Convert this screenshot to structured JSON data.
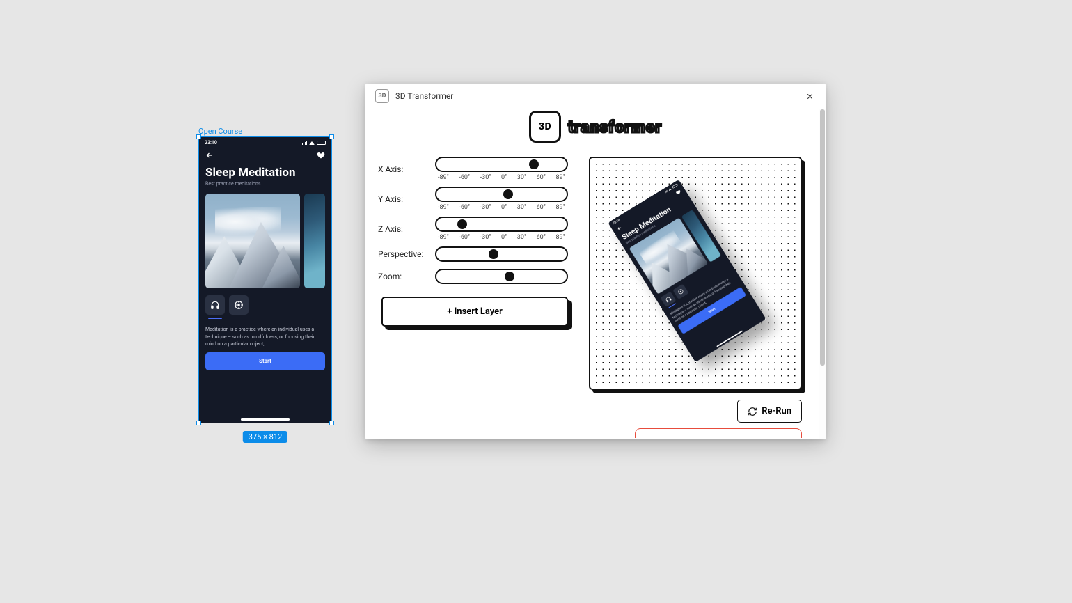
{
  "frame": {
    "label": "Open Course",
    "size_badge": "375 × 812"
  },
  "phone": {
    "status_time": "23:10",
    "title": "Sleep Meditation",
    "subtitle": "Best practice meditations",
    "description": "Meditation is a practice where an individual uses a technique – such as mindfulness, or focusing their mind on a particular object,",
    "start_label": "Start"
  },
  "plugin": {
    "window_title": "3D Transformer",
    "icon_label": "3D",
    "logo_text": "transformer",
    "logo_badge": "3D",
    "ticks": [
      "-89°",
      "-60°",
      "-30°",
      "0°",
      "30°",
      "60°",
      "89°"
    ],
    "controls": [
      {
        "label": "X Axis:",
        "knob_pct": 75,
        "show_ticks": true
      },
      {
        "label": "Y Axis:",
        "knob_pct": 55,
        "show_ticks": true
      },
      {
        "label": "Z Axis:",
        "knob_pct": 20,
        "show_ticks": true
      },
      {
        "label": "Perspective:",
        "knob_pct": 44,
        "show_ticks": false
      },
      {
        "label": "Zoom:",
        "knob_pct": 56,
        "show_ticks": false
      }
    ],
    "insert_label": "+ Insert Layer",
    "rerun_label": "Re-Run"
  }
}
